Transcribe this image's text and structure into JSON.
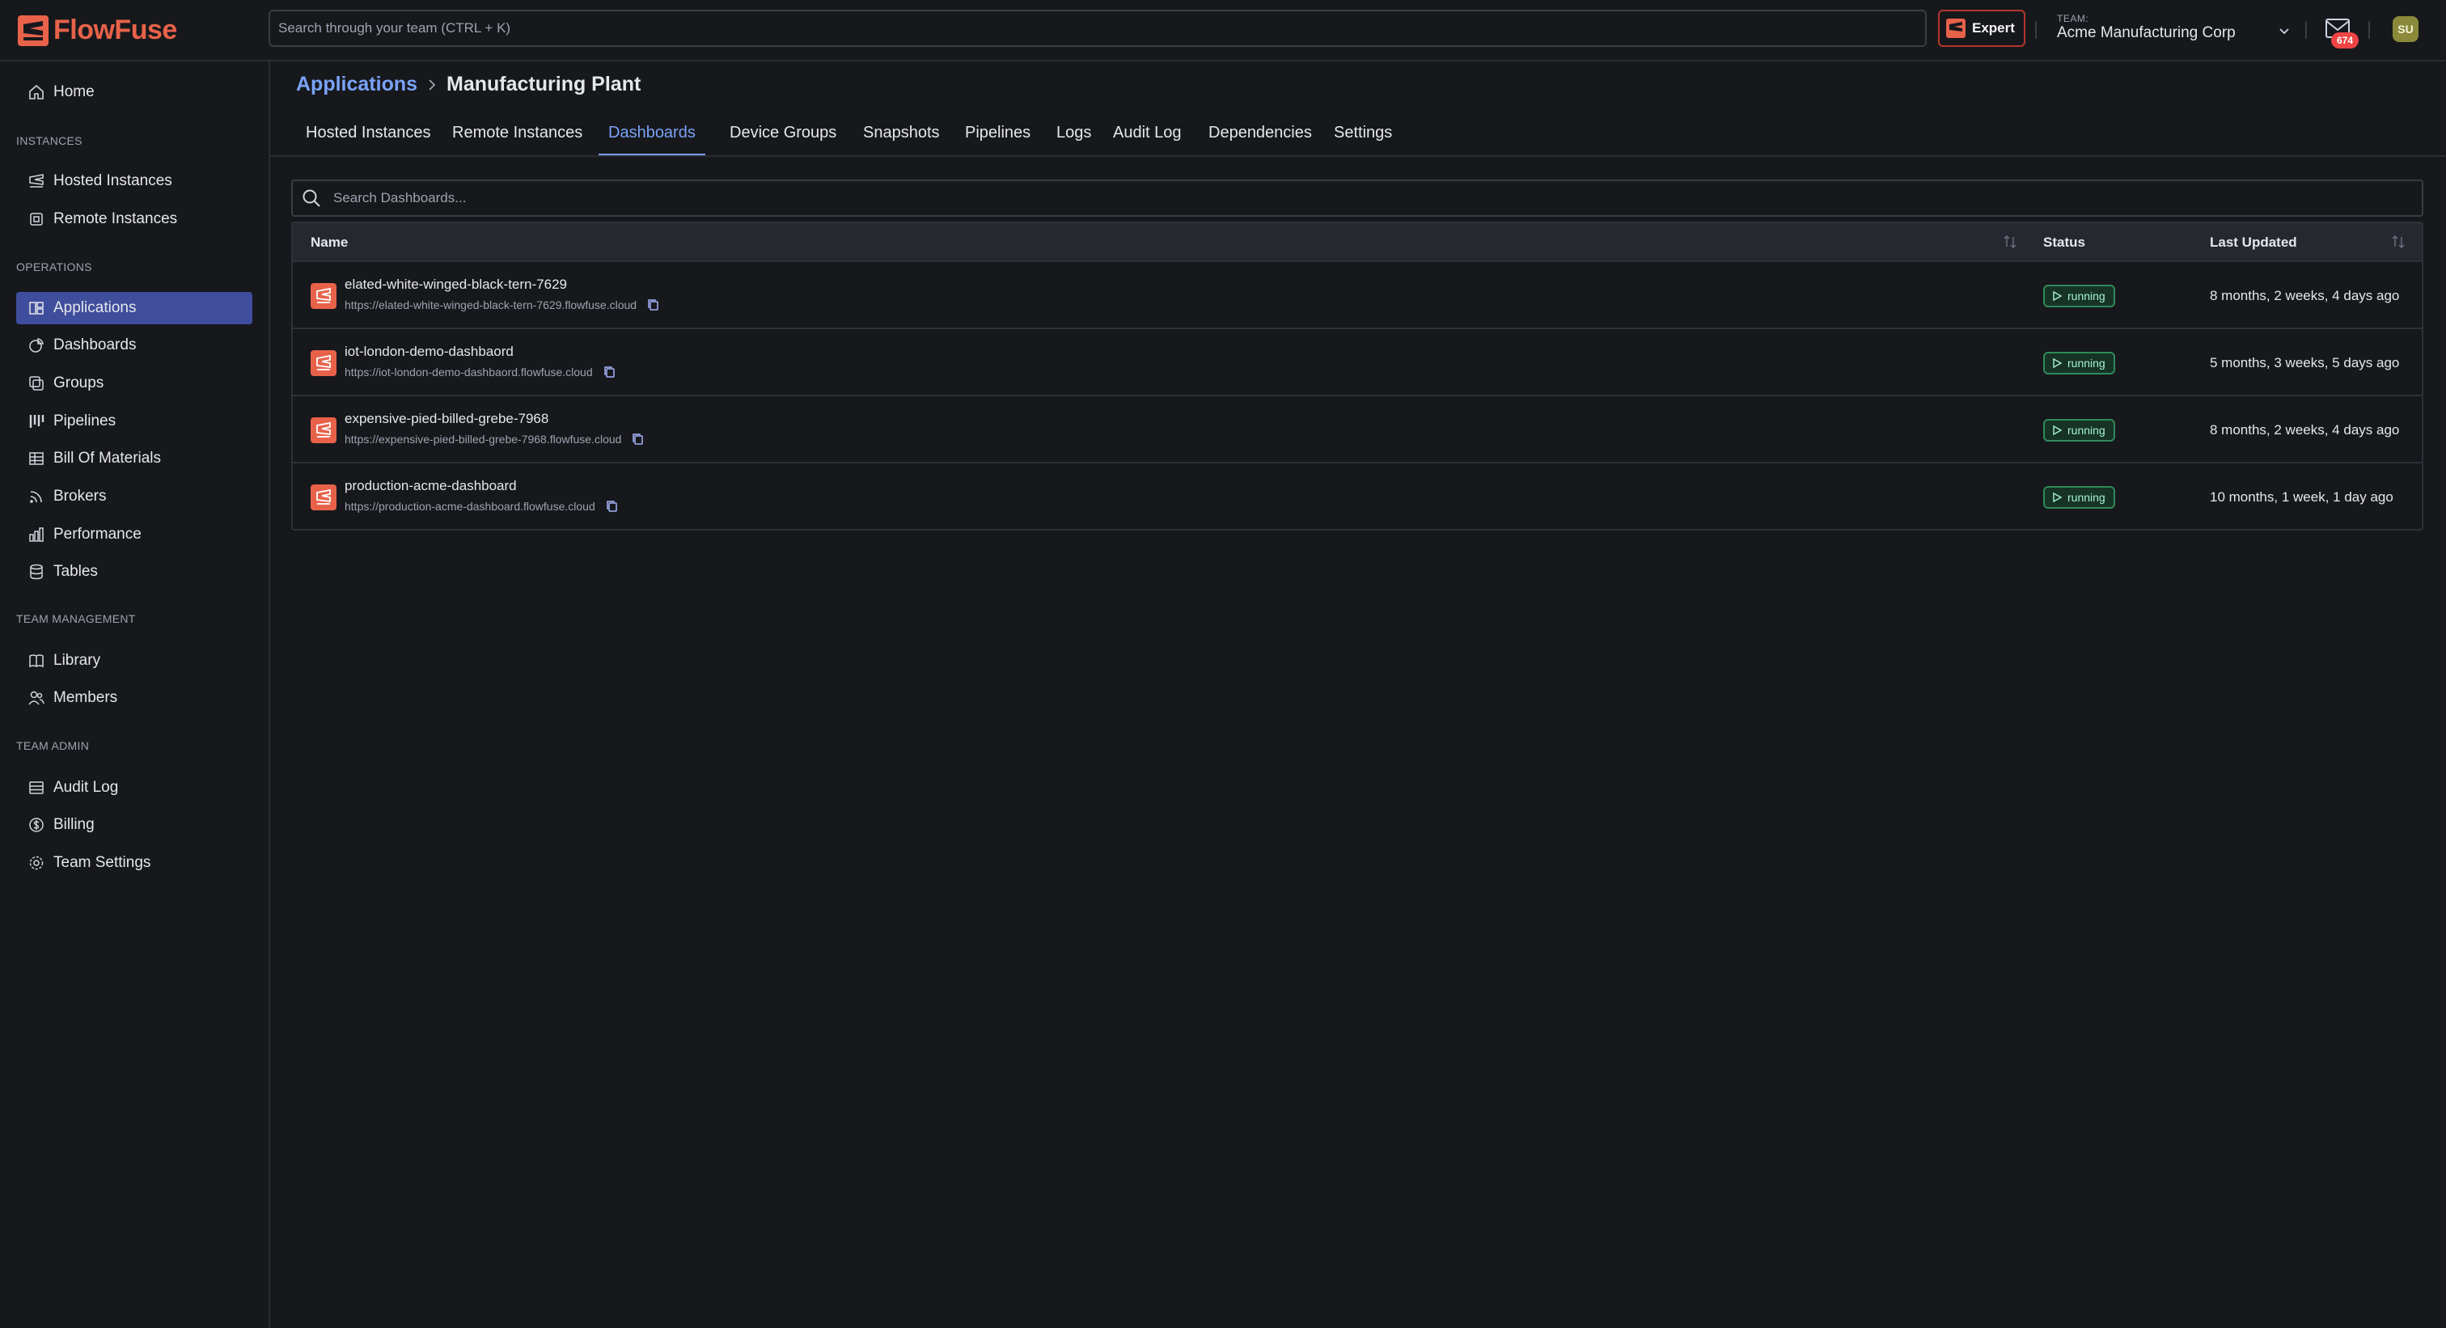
{
  "header": {
    "brand": "FlowFuse",
    "search_placeholder": "Search through your team (CTRL + K)",
    "expert_label": "Expert",
    "team_label": "TEAM:",
    "team_name": "Acme Manufacturing Corp",
    "notification_count": "674",
    "avatar_initials": "SU"
  },
  "sidebar": {
    "home": "Home",
    "sections": {
      "instances": "INSTANCES",
      "operations": "OPERATIONS",
      "team_management": "TEAM MANAGEMENT",
      "team_admin": "TEAM ADMIN"
    },
    "instances": [
      "Hosted Instances",
      "Remote Instances"
    ],
    "operations": [
      "Applications",
      "Dashboards",
      "Groups",
      "Pipelines",
      "Bill Of Materials",
      "Brokers",
      "Performance",
      "Tables"
    ],
    "team_management": [
      "Library",
      "Members"
    ],
    "team_admin": [
      "Audit Log",
      "Billing",
      "Team Settings"
    ]
  },
  "breadcrumb": {
    "parent": "Applications",
    "current": "Manufacturing Plant"
  },
  "tabs": [
    "Hosted Instances",
    "Remote Instances",
    "Dashboards",
    "Device Groups",
    "Snapshots",
    "Pipelines",
    "Logs",
    "Audit Log",
    "Dependencies",
    "Settings"
  ],
  "active_tab": "Dashboards",
  "dashboards": {
    "search_placeholder": "Search Dashboards...",
    "columns": [
      "Name",
      "Status",
      "Last Updated"
    ],
    "rows": [
      {
        "name": "elated-white-winged-black-tern-7629",
        "url": "https://elated-white-winged-black-tern-7629.flowfuse.cloud",
        "status": "running",
        "updated": "8 months, 2 weeks, 4 days ago"
      },
      {
        "name": "iot-london-demo-dashbaord",
        "url": "https://iot-london-demo-dashbaord.flowfuse.cloud",
        "status": "running",
        "updated": "5 months, 3 weeks, 5 days ago"
      },
      {
        "name": "expensive-pied-billed-grebe-7968",
        "url": "https://expensive-pied-billed-grebe-7968.flowfuse.cloud",
        "status": "running",
        "updated": "8 months, 2 weeks, 4 days ago"
      },
      {
        "name": "production-acme-dashboard",
        "url": "https://production-acme-dashboard.flowfuse.cloud",
        "status": "running",
        "updated": "10 months, 1 week, 1 day ago"
      }
    ]
  },
  "colors": {
    "brand": "#e8624a",
    "accent": "#7aa2f7",
    "active_nav": "#3f4e9c",
    "running": "#2f8a5a"
  }
}
